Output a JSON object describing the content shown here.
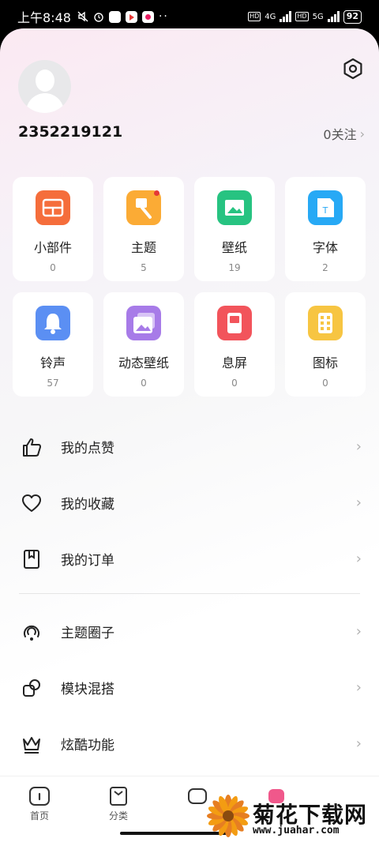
{
  "status_bar": {
    "time": "上午8:48",
    "net1": "4G",
    "net2": "5G",
    "battery": "92"
  },
  "profile": {
    "user_id": "2352219121",
    "follow_label": "0关注"
  },
  "grid": [
    {
      "name": "小部件",
      "count": "0",
      "icon": "widget-icon",
      "color": "#f56d3b"
    },
    {
      "name": "主题",
      "count": "5",
      "icon": "brush-icon",
      "color": "#fbab35",
      "badge": true
    },
    {
      "name": "壁纸",
      "count": "19",
      "icon": "wallpaper-icon",
      "color": "#27c381"
    },
    {
      "name": "字体",
      "count": "2",
      "icon": "font-icon",
      "color": "#27a9f5"
    },
    {
      "name": "铃声",
      "count": "57",
      "icon": "bell-icon",
      "color": "#5b8ff3"
    },
    {
      "name": "动态壁纸",
      "count": "0",
      "icon": "live-wallpaper-icon",
      "color": "#a77be8"
    },
    {
      "name": "息屏",
      "count": "0",
      "icon": "aod-icon",
      "color": "#f2545b"
    },
    {
      "name": "图标",
      "count": "0",
      "icon": "app-icon-icon",
      "color": "#f7c542"
    }
  ],
  "menu_group1": [
    {
      "label": "我的点赞",
      "icon": "thumbs-up-icon"
    },
    {
      "label": "我的收藏",
      "icon": "heart-icon"
    },
    {
      "label": "我的订单",
      "icon": "order-icon"
    }
  ],
  "menu_group2": [
    {
      "label": "主题圈子",
      "icon": "circle-icon"
    },
    {
      "label": "模块混搭",
      "icon": "mix-icon"
    },
    {
      "label": "炫酷功能",
      "icon": "crown-icon"
    }
  ],
  "nav": [
    {
      "label": "首页",
      "icon": "home-icon"
    },
    {
      "label": "分类",
      "icon": "category-icon"
    }
  ],
  "watermark": {
    "title": "菊花下载网",
    "url": "www.juahar.com"
  }
}
